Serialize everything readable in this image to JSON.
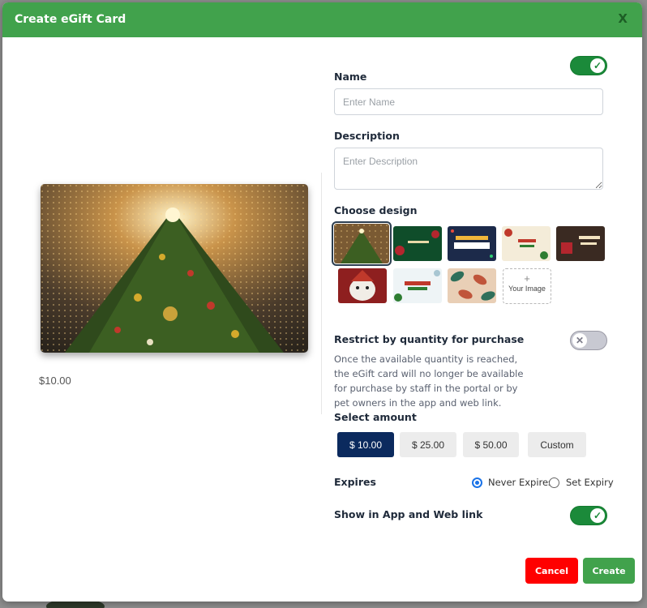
{
  "modal": {
    "title": "Create eGift Card",
    "close_label": "X"
  },
  "preview": {
    "image_icon": "christmas-tree-image",
    "price": "$10.00"
  },
  "form": {
    "name": {
      "label": "Name",
      "placeholder": "Enter Name",
      "value": ""
    },
    "description": {
      "label": "Description",
      "placeholder": "Enter Description",
      "value": ""
    },
    "active_toggle": {
      "on": true
    },
    "design": {
      "label": "Choose design",
      "thumbnails": [
        {
          "id": "christmas-tree",
          "selected": true
        },
        {
          "id": "happy-new-year"
        },
        {
          "id": "happy-birthday"
        },
        {
          "id": "merry-christmas-ornaments"
        },
        {
          "id": "merry-christmas-gifts"
        },
        {
          "id": "santa-dog"
        },
        {
          "id": "merry-christmas-snow"
        },
        {
          "id": "leaf-pattern"
        }
      ],
      "upload_label": "Your Image",
      "upload_plus": "+"
    },
    "restrict": {
      "label": "Restrict by quantity for purchase",
      "on": false,
      "description": "Once the available quantity is reached, the eGift card will no longer be available for purchase by staff in the portal or by pet owners in the app and web link."
    },
    "amount": {
      "label": "Select amount",
      "options": [
        "$ 10.00",
        "$ 25.00",
        "$ 50.00",
        "Custom"
      ],
      "selected": "$ 10.00"
    },
    "expires": {
      "label": "Expires",
      "options": [
        "Never Expires",
        "Set Expiry"
      ],
      "selected": "Never Expires"
    },
    "show_in_app": {
      "label": "Show in App and Web link",
      "on": true
    }
  },
  "footer": {
    "cancel_label": "Cancel",
    "create_label": "Create"
  },
  "colors": {
    "header": "#41a24c",
    "toggle_on": "#1b8a3a",
    "amount_selected": "#0b2a5e",
    "cancel": "#ff0000",
    "create": "#41a24c"
  }
}
